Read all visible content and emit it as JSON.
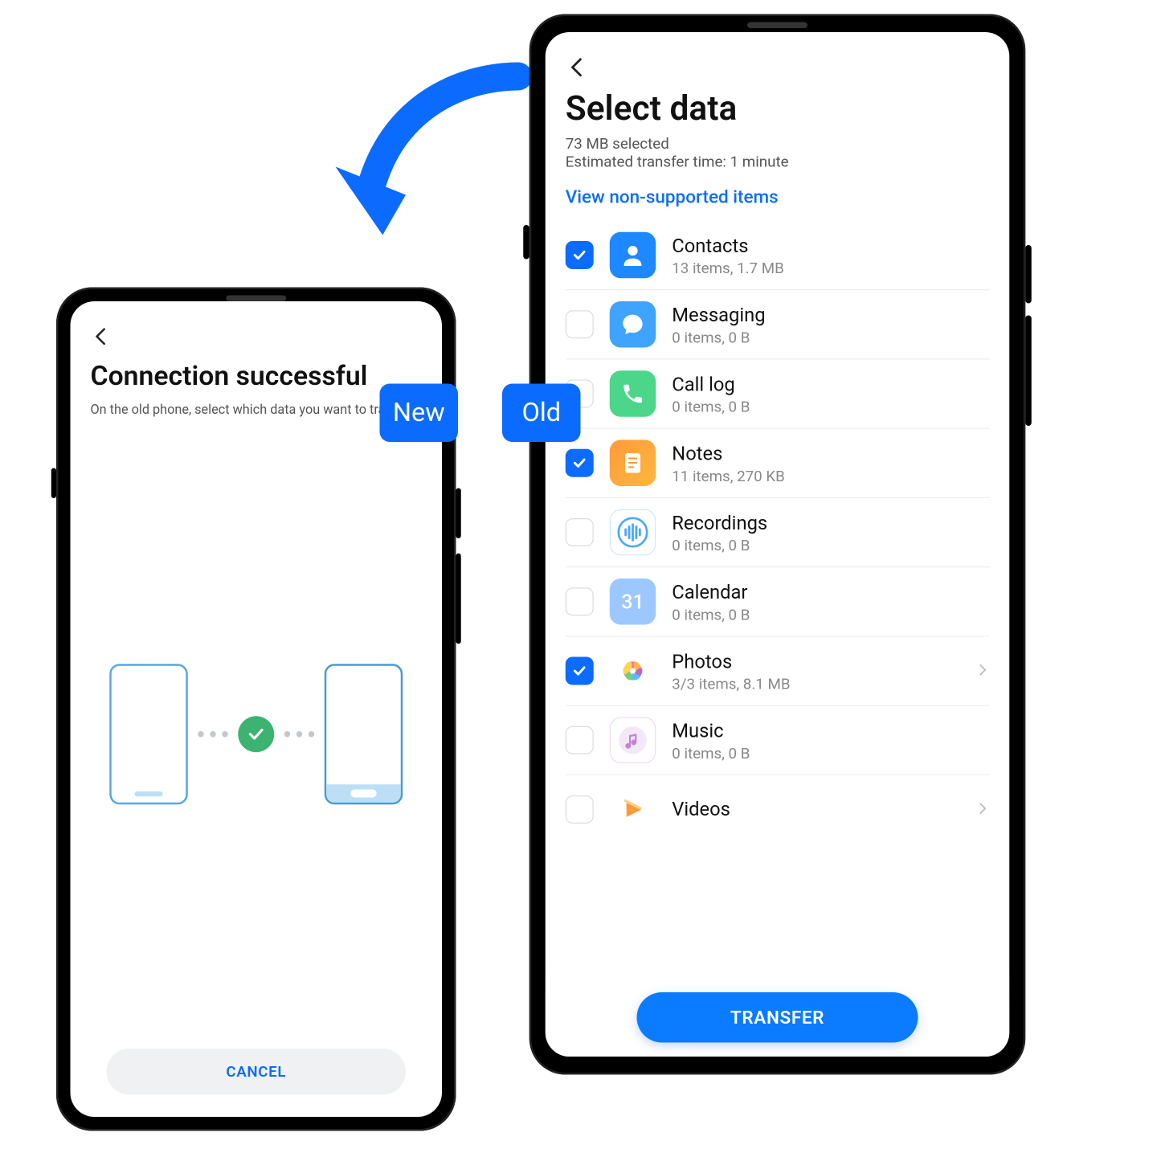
{
  "badges": {
    "new": "New",
    "old": "Old"
  },
  "leftPhone": {
    "title": "Connection successful",
    "subtitle": "On the old phone, select which data you want to transfer.",
    "cancel": "CANCEL"
  },
  "rightPhone": {
    "title": "Select data",
    "selectedLine": "73 MB selected",
    "etaLine": "Estimated transfer time: 1 minute",
    "viewLink": "View non-supported items",
    "transfer": "TRANSFER",
    "items": [
      {
        "title": "Contacts",
        "sub": "13 items, 1.7 MB",
        "checked": true,
        "arrow": false
      },
      {
        "title": "Messaging",
        "sub": "0 items, 0 B",
        "checked": false,
        "arrow": false
      },
      {
        "title": "Call log",
        "sub": "0 items, 0 B",
        "checked": false,
        "arrow": false
      },
      {
        "title": "Notes",
        "sub": "11 items, 270 KB",
        "checked": true,
        "arrow": false
      },
      {
        "title": "Recordings",
        "sub": "0 items, 0 B",
        "checked": false,
        "arrow": false
      },
      {
        "title": "Calendar",
        "sub": "0 items, 0 B",
        "checked": false,
        "arrow": false
      },
      {
        "title": "Photos",
        "sub": "3/3 items, 8.1 MB",
        "checked": true,
        "arrow": true
      },
      {
        "title": "Music",
        "sub": "0 items, 0 B",
        "checked": false,
        "arrow": false
      },
      {
        "title": "Videos",
        "sub": "",
        "checked": false,
        "arrow": true
      }
    ],
    "calDay": "31"
  }
}
